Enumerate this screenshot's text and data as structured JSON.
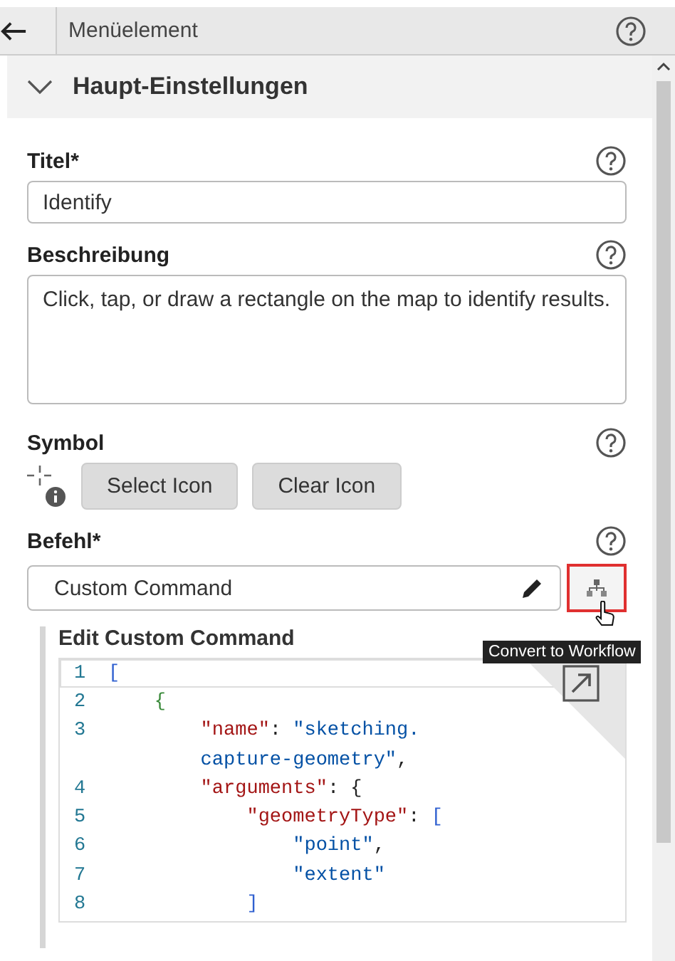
{
  "header": {
    "title": "Menüelement"
  },
  "section": {
    "title": "Haupt-Einstellungen",
    "expanded": true
  },
  "fields": [
    {
      "kind": "text",
      "label": "Titel*",
      "value": "Identify"
    },
    {
      "kind": "textarea",
      "label": "Beschreibung",
      "value": "Click, tap, or draw a rectangle on the map to identify results."
    },
    {
      "kind": "symbol",
      "label": "Symbol",
      "buttons": [
        "Select Icon",
        "Clear Icon"
      ]
    },
    {
      "kind": "command",
      "label": "Befehl*",
      "value": "Custom Command",
      "tooltip": "Convert to Workflow"
    }
  ],
  "editor": {
    "title": "Edit Custom Command",
    "lines": [
      {
        "number": "1",
        "current": true,
        "tokens": [
          {
            "text": "[",
            "kind": "bracket"
          }
        ]
      },
      {
        "number": "2",
        "current": false,
        "tokens": [
          {
            "text": "    {",
            "kind": "brace"
          }
        ]
      },
      {
        "number": "3",
        "current": false,
        "tokens": [
          {
            "text": "        \"name\"",
            "kind": "key"
          },
          {
            "text": ": ",
            "kind": "punct"
          },
          {
            "text": "\"sketching.",
            "kind": "string"
          }
        ]
      },
      {
        "current": false,
        "tokens": [
          {
            "text": "        capture-geometry\"",
            "kind": "string"
          },
          {
            "text": ",",
            "kind": "punct"
          }
        ]
      },
      {
        "number": "4",
        "current": false,
        "tokens": [
          {
            "text": "        \"arguments\"",
            "kind": "key"
          },
          {
            "text": ": {",
            "kind": "punct"
          }
        ]
      },
      {
        "number": "5",
        "current": false,
        "tokens": [
          {
            "text": "            \"geometryType\"",
            "kind": "key"
          },
          {
            "text": ": ",
            "kind": "punct"
          },
          {
            "text": "[",
            "kind": "bracket"
          }
        ]
      },
      {
        "number": "6",
        "current": false,
        "tokens": [
          {
            "text": "                \"point\"",
            "kind": "string"
          },
          {
            "text": ",",
            "kind": "punct"
          }
        ]
      },
      {
        "number": "7",
        "current": false,
        "tokens": [
          {
            "text": "                \"extent\"",
            "kind": "string"
          }
        ]
      },
      {
        "number": "8",
        "current": false,
        "tokens": [
          {
            "text": "            ]",
            "kind": "bracket"
          }
        ]
      }
    ]
  }
}
